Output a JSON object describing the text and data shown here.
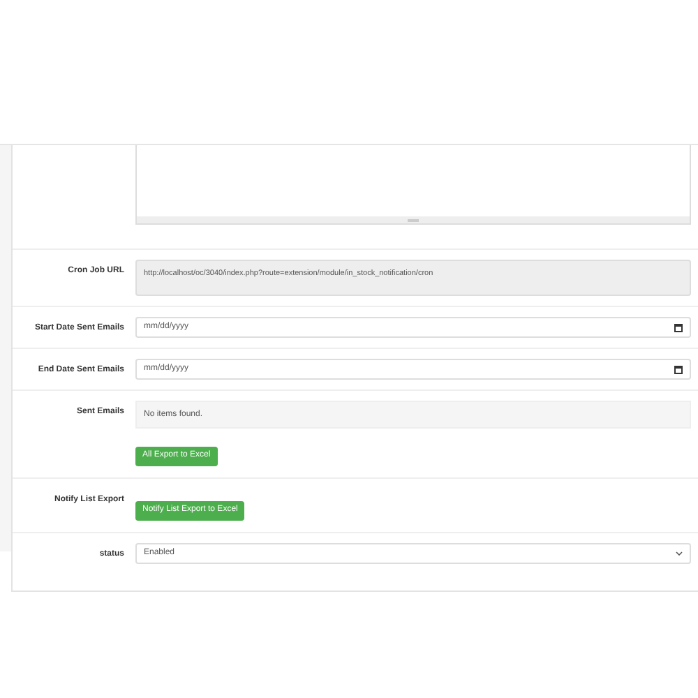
{
  "form": {
    "rows": [
      {
        "kind": "textarea",
        "label": "",
        "value": ""
      },
      {
        "kind": "readonly",
        "label": "Cron Job URL",
        "value": "http://localhost/oc/3040/index.php?route=extension/module/in_stock_notification/cron"
      },
      {
        "kind": "date",
        "label": "Start Date Sent Emails",
        "placeholder": "mm/dd/yyyy"
      },
      {
        "kind": "date",
        "label": "End Date Sent Emails",
        "placeholder": "mm/dd/yyyy"
      },
      {
        "kind": "list",
        "label": "Sent Emails",
        "message": "No items found.",
        "button": "All Export to Excel"
      },
      {
        "kind": "button",
        "label": "Notify List Export",
        "button": "Notify List Export to Excel"
      },
      {
        "kind": "select",
        "label": "status",
        "value": "Enabled"
      }
    ]
  }
}
